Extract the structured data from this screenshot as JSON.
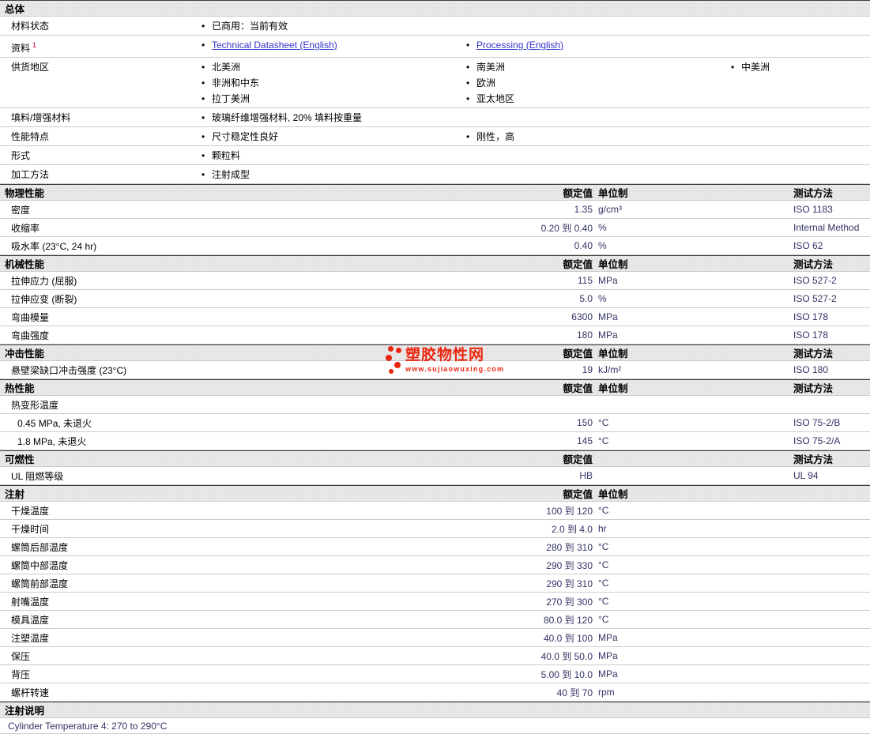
{
  "colors": {
    "link": "#3333cc",
    "value_text": "#333366",
    "band_background": "#e6e6e6",
    "watermark_red": "#e8250f",
    "row_divider": "#cccccc"
  },
  "watermark": {
    "name": "塑胶物性网",
    "url": "www.sujiaowuxing.com",
    "logo_icon": "red-dots-cluster-icon"
  },
  "general": {
    "title": "总体",
    "rows": [
      {
        "label": "材料状态",
        "cols": [
          [
            {
              "text": "已商用：当前有效"
            }
          ]
        ]
      },
      {
        "label": "资料",
        "sup": "1",
        "cols": [
          [
            {
              "text": "Technical Datasheet (English)",
              "link": true
            }
          ],
          [
            {
              "text": "Processing (English)",
              "link": true
            }
          ]
        ]
      },
      {
        "label": "供货地区",
        "cols": [
          [
            {
              "text": "北美洲"
            },
            {
              "text": "非洲和中东"
            },
            {
              "text": "拉丁美洲"
            }
          ],
          [
            {
              "text": "南美洲"
            },
            {
              "text": "欧洲"
            },
            {
              "text": "亚太地区"
            }
          ],
          [
            {
              "text": "中美洲"
            }
          ]
        ]
      },
      {
        "label": "填料/增强材料",
        "cols": [
          [
            {
              "text": "玻璃纤维增强材料, 20% 填料按重量"
            }
          ]
        ]
      },
      {
        "label": "性能特点",
        "cols": [
          [
            {
              "text": "尺寸稳定性良好"
            }
          ],
          [
            {
              "text": "刚性，高"
            }
          ]
        ]
      },
      {
        "label": "形式",
        "cols": [
          [
            {
              "text": "颗粒料"
            }
          ]
        ]
      },
      {
        "label": "加工方法",
        "cols": [
          [
            {
              "text": "注射成型"
            }
          ]
        ]
      }
    ]
  },
  "property_sections": [
    {
      "title": "物理性能",
      "headers": {
        "value": "额定值",
        "unit": "单位制",
        "test": "测试方法"
      },
      "rows": [
        {
          "label": "密度",
          "value": "1.35",
          "unit": "g/cm³",
          "test": "ISO 1183"
        },
        {
          "label": "收缩率",
          "value": "0.20 到 0.40",
          "unit": "%",
          "test": "Internal Method"
        },
        {
          "label": "吸水率 (23°C, 24 hr)",
          "value": "0.40",
          "unit": "%",
          "test": "ISO 62"
        }
      ]
    },
    {
      "title": "机械性能",
      "headers": {
        "value": "额定值",
        "unit": "单位制",
        "test": "测试方法"
      },
      "rows": [
        {
          "label": "拉伸应力 (屈服)",
          "value": "115",
          "unit": "MPa",
          "test": "ISO 527-2"
        },
        {
          "label": "拉伸应变 (断裂)",
          "value": "5.0",
          "unit": "%",
          "test": "ISO 527-2"
        },
        {
          "label": "弯曲模量",
          "value": "6300",
          "unit": "MPa",
          "test": "ISO 178"
        },
        {
          "label": "弯曲强度",
          "value": "180",
          "unit": "MPa",
          "test": "ISO 178"
        }
      ]
    },
    {
      "title": "冲击性能",
      "headers": {
        "value": "额定值",
        "unit": "单位制",
        "test": "测试方法"
      },
      "rows": [
        {
          "label": "悬壁梁缺口冲击强度 (23°C)",
          "value": "19",
          "unit": "kJ/m²",
          "test": "ISO 180"
        }
      ]
    },
    {
      "title": "热性能",
      "headers": {
        "value": "额定值",
        "unit": "单位制",
        "test": "测试方法"
      },
      "rows": [
        {
          "label": "热变形温度"
        },
        {
          "label": "0.45 MPa, 未退火",
          "indent": true,
          "value": "150",
          "unit": "°C",
          "test": "ISO 75-2/B"
        },
        {
          "label": "1.8 MPa, 未退火",
          "indent": true,
          "value": "145",
          "unit": "°C",
          "test": "ISO 75-2/A"
        }
      ]
    },
    {
      "title": "可燃性",
      "headers": {
        "value": "额定值",
        "test": "测试方法"
      },
      "rows": [
        {
          "label": "UL 阻燃等级",
          "value": "HB",
          "test": "UL 94"
        }
      ]
    },
    {
      "title": "注射",
      "headers": {
        "value": "额定值",
        "unit": "单位制"
      },
      "rows": [
        {
          "label": "干燥温度",
          "value": "100 到 120",
          "unit": "°C"
        },
        {
          "label": "干燥时间",
          "value": "2.0 到 4.0",
          "unit": "hr"
        },
        {
          "label": "螺筒后部温度",
          "value": "280 到 310",
          "unit": "°C"
        },
        {
          "label": "螺筒中部温度",
          "value": "290 到 330",
          "unit": "°C"
        },
        {
          "label": "螺筒前部温度",
          "value": "290 到 310",
          "unit": "°C"
        },
        {
          "label": "射嘴温度",
          "value": "270 到 300",
          "unit": "°C"
        },
        {
          "label": "模具温度",
          "value": "80.0 到 120",
          "unit": "°C"
        },
        {
          "label": "注塑温度",
          "value": "40.0 到 100",
          "unit": "MPa"
        },
        {
          "label": "保压",
          "value": "40.0 到 50.0",
          "unit": "MPa"
        },
        {
          "label": "背压",
          "value": "5.00 到 10.0",
          "unit": "MPa"
        },
        {
          "label": "螺杆转速",
          "value": "40 到 70",
          "unit": "rpm"
        }
      ]
    }
  ],
  "notes": {
    "title": "注射说明",
    "text": "Cylinder Temperature 4: 270 to 290°C"
  }
}
